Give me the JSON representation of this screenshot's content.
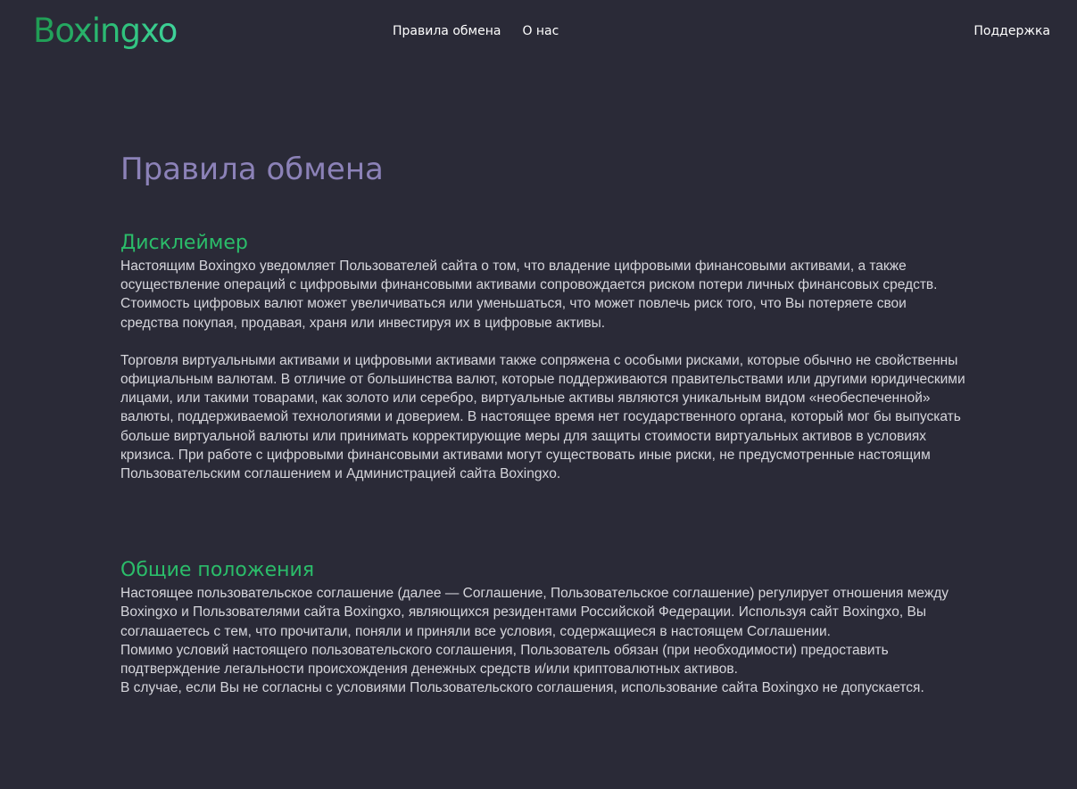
{
  "header": {
    "logo": "Boxingxo",
    "nav": [
      "Правила обмена",
      "О нас"
    ],
    "support": "Поддержка"
  },
  "page": {
    "title": "Правила обмена"
  },
  "sections": [
    {
      "heading": "Дисклеймер",
      "paragraphs": [
        "Настоящим Boxingxo уведомляет Пользователей сайта о том, что владение цифровыми финансовыми активами, а также осуществление операций с цифровыми финансовыми активами сопровождается риском потери личных финансовых средств. Стоимость цифровых валют может увеличиваться или уменьшаться, что может повлечь риск того, что Вы потеряете свои средства покупая, продавая, храня или инвестируя их в цифровые активы.",
        "Торговля виртуальными активами и цифровыми активами также сопряжена с особыми рисками, которые обычно не свойственны официальным валютам. В отличие от большинства валют, которые поддерживаются правительствами или другими юридическими лицами, или такими товарами, как золото или серебро, виртуальные активы являются уникальным видом «необеспеченной» валюты, поддерживаемой технологиями и доверием. В настоящее время нет государственного органа, который мог бы выпускать больше виртуальной валюты или принимать корректирующие меры для защиты стоимости виртуальных активов в условиях кризиса. При работе с цифровыми финансовыми активами могут существовать иные риски, не предусмотренные настоящим Пользовательским соглашением и Администрацией сайта Boxingxo."
      ]
    },
    {
      "heading": "Общие положения",
      "paragraphs": [
        "Настоящее пользовательское соглашение (далее — Соглашение, Пользовательское соглашение) регулирует отношения между Boxingxo и Пользователями сайта Boxingxo, являющихся резидентами Российской Федерации. Используя сайт Boxingxo, Вы соглашаетесь с тем, что прочитали, поняли и приняли все условия, содержащиеся в настоящем Соглашении.",
        "Помимо условий настоящего пользовательского соглашения, Пользователь обязан (при необходимости) предоставить подтверждение легальности происхождения денежных средств и/или криптовалютных активов.",
        "В случае, если Вы не согласны с условиями Пользовательского соглашения, использование сайта Boxingxo не допускается."
      ]
    }
  ]
}
